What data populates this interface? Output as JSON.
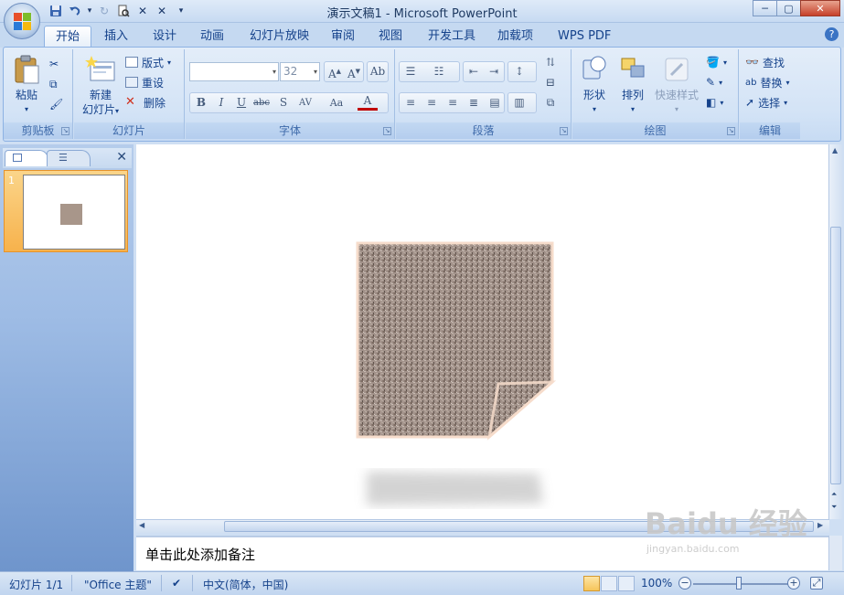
{
  "window": {
    "title": "演示文稿1 - Microsoft PowerPoint",
    "controls": {
      "minimize": "─",
      "maximize": "▢",
      "close": "✕"
    }
  },
  "quick_access": {
    "items": [
      {
        "name": "save-icon",
        "glyph": "💾"
      },
      {
        "name": "undo-icon",
        "glyph": "↶"
      },
      {
        "name": "undo-dropdown-icon",
        "glyph": "▾"
      },
      {
        "name": "redo-icon",
        "glyph": "↻"
      },
      {
        "name": "print-preview-icon",
        "glyph": "🔍"
      },
      {
        "name": "x-icon-1",
        "glyph": "✕"
      },
      {
        "name": "x-icon-2",
        "glyph": "✕"
      },
      {
        "name": "customize-qat-icon",
        "glyph": "▾"
      }
    ]
  },
  "tabs": [
    "开始",
    "插入",
    "设计",
    "动画",
    "幻灯片放映",
    "审阅",
    "视图",
    "开发工具",
    "加载项",
    "WPS PDF"
  ],
  "active_tab": "开始",
  "ribbon": {
    "clipboard": {
      "label": "剪贴板",
      "paste": "粘贴"
    },
    "slides": {
      "label": "幻灯片",
      "new_slide_line1": "新建",
      "new_slide_line2": "幻灯片",
      "layout": "版式",
      "reset": "重设",
      "delete": "删除"
    },
    "font": {
      "label": "字体",
      "font_name": "",
      "font_size": "32",
      "buttons": [
        "B",
        "I",
        "U",
        "abc",
        "S",
        "AV",
        "Aa",
        "A"
      ]
    },
    "paragraph": {
      "label": "段落"
    },
    "drawing": {
      "label": "绘图",
      "shapes": "形状",
      "arrange": "排列",
      "quick_styles": "快速样式"
    },
    "editing": {
      "label": "编辑",
      "find": "查找",
      "replace": "替换",
      "select": "选择"
    }
  },
  "slide_panel": {
    "slide_number": "1",
    "close": "✕"
  },
  "notes": {
    "placeholder": "单击此处添加备注"
  },
  "status_bar": {
    "slide_info": "幻灯片 1/1",
    "theme": "\"Office 主题\"",
    "language": "中文(简体，中国)",
    "zoom": "100%"
  },
  "watermark": {
    "line1": "Baidu 经验",
    "line2": "jingyan.baidu.com"
  },
  "colors": {
    "accent": "#15428b",
    "shape_fill": "#a8968a",
    "shape_outline": "#f6dccb",
    "active_slide": "#f7b24c"
  }
}
